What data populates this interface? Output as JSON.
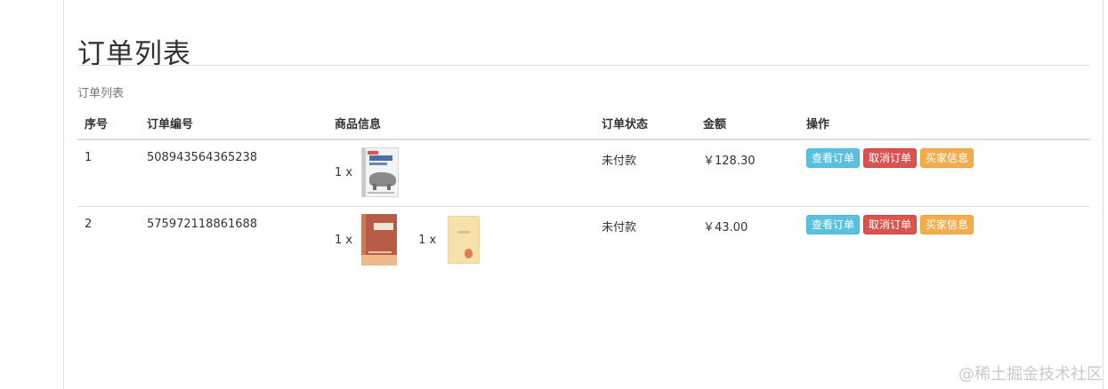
{
  "page": {
    "title": "订单列表",
    "caption": "订单列表"
  },
  "table": {
    "headers": {
      "index": "序号",
      "order_no": "订单编号",
      "goods": "商品信息",
      "status": "订单状态",
      "amount": "金额",
      "ops": "操作"
    },
    "rows": [
      {
        "index": "1",
        "order_no": "508943564365238",
        "items": [
          {
            "qty": "1 x",
            "cover": "javascript-book-cover"
          }
        ],
        "status": "未付款",
        "amount": "￥128.30"
      },
      {
        "index": "2",
        "order_no": "575972118861688",
        "items": [
          {
            "qty": "1 x",
            "cover": "brown-book-cover"
          },
          {
            "qty": "1 x",
            "cover": "cream-book-cover"
          }
        ],
        "status": "未付款",
        "amount": "￥43.00"
      }
    ],
    "actions": {
      "view": "查看订单",
      "cancel": "取消订单",
      "seller": "买家信息"
    }
  },
  "colors": {
    "info": "#5bc0de",
    "danger": "#d9534f",
    "warning": "#f0ad4e",
    "amount": "#d9534f"
  },
  "watermark": "@稀土掘金技术社区"
}
